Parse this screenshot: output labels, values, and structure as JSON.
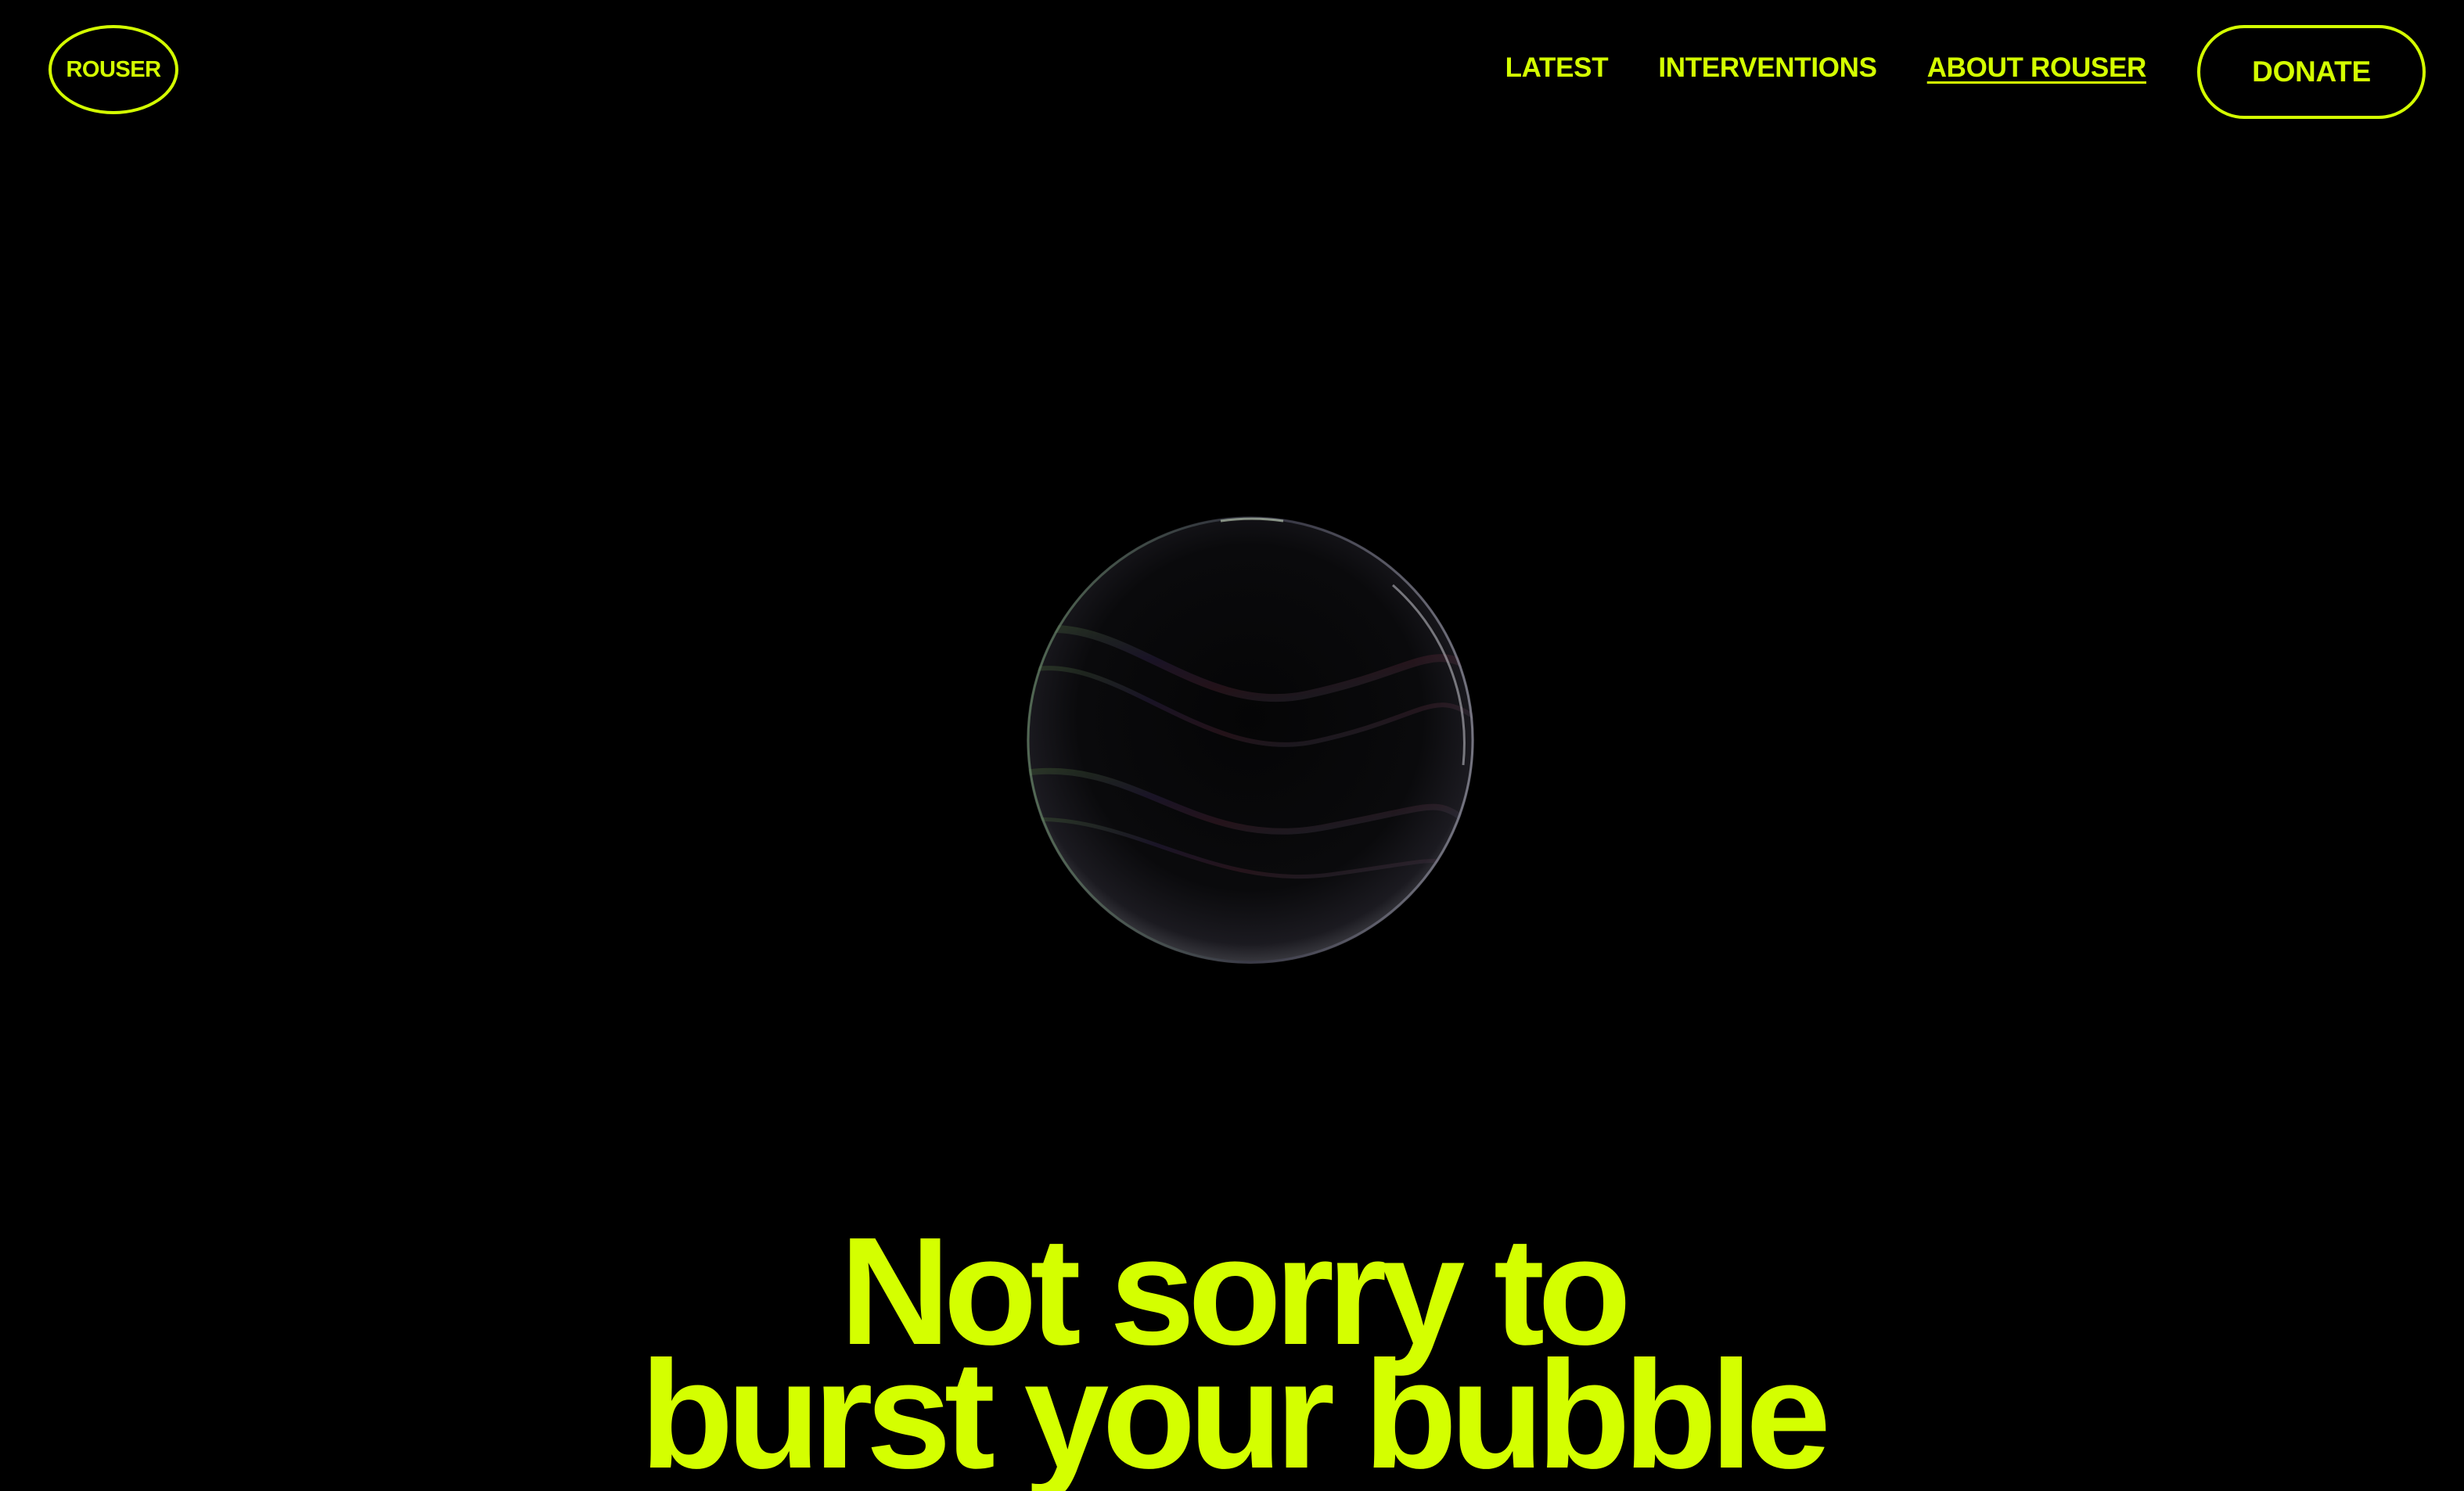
{
  "brand": {
    "logo_text": "ROUSER",
    "accent_color": "#d4ff00",
    "background_color": "#000000"
  },
  "nav": {
    "items": [
      {
        "label": "LATEST",
        "active": false
      },
      {
        "label": "INTERVENTIONS",
        "active": false
      },
      {
        "label": "ABOUT ROUSER",
        "active": true
      }
    ],
    "donate_label": "DONATE"
  },
  "hero": {
    "graphic": "soap-bubble",
    "headline_line1": "Not sorry to",
    "headline_line2": "burst your bubble"
  }
}
